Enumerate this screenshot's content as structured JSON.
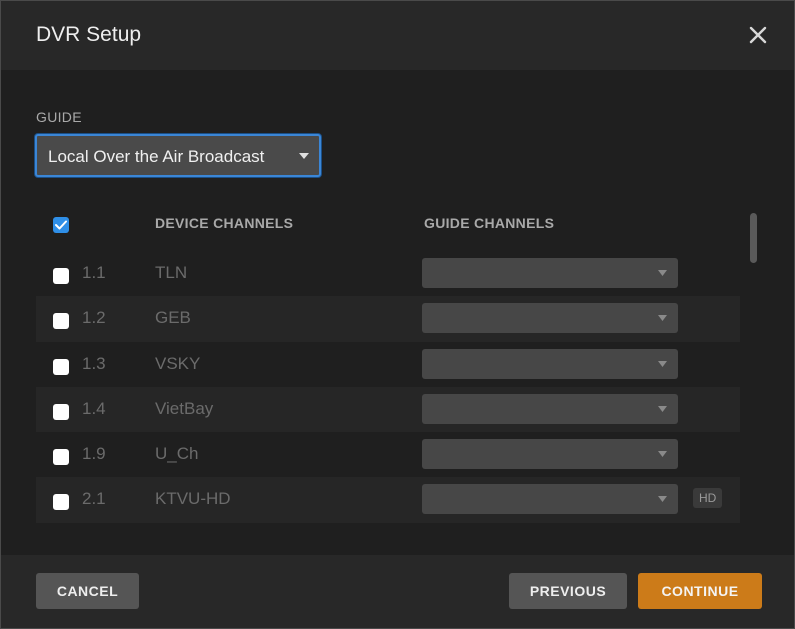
{
  "dialog": {
    "title": "DVR Setup"
  },
  "guide": {
    "label": "GUIDE",
    "selected": "Local Over the Air Broadcast"
  },
  "table": {
    "headers": {
      "device_channels": "DEVICE CHANNELS",
      "guide_channels": "GUIDE CHANNELS"
    },
    "select_all_checked": true,
    "rows": [
      {
        "number": "1.1",
        "name": "TLN",
        "checked": false,
        "guide_channel": "",
        "badge": ""
      },
      {
        "number": "1.2",
        "name": "GEB",
        "checked": false,
        "guide_channel": "",
        "badge": ""
      },
      {
        "number": "1.3",
        "name": "VSKY",
        "checked": false,
        "guide_channel": "",
        "badge": ""
      },
      {
        "number": "1.4",
        "name": "VietBay",
        "checked": false,
        "guide_channel": "",
        "badge": ""
      },
      {
        "number": "1.9",
        "name": "U_Ch",
        "checked": false,
        "guide_channel": "",
        "badge": ""
      },
      {
        "number": "2.1",
        "name": "KTVU-HD",
        "checked": false,
        "guide_channel": "",
        "badge": "HD"
      }
    ]
  },
  "footer": {
    "cancel_label": "CANCEL",
    "previous_label": "PREVIOUS",
    "continue_label": "CONTINUE"
  },
  "colors": {
    "accent_blue": "#2f8fe8",
    "continue_orange": "#cc7b19",
    "dialog_bg": "#1f1f1f",
    "header_bg": "#282828"
  },
  "icons": {
    "close": "close-icon",
    "dropdown": "chevron-down-icon",
    "check": "check-icon"
  }
}
